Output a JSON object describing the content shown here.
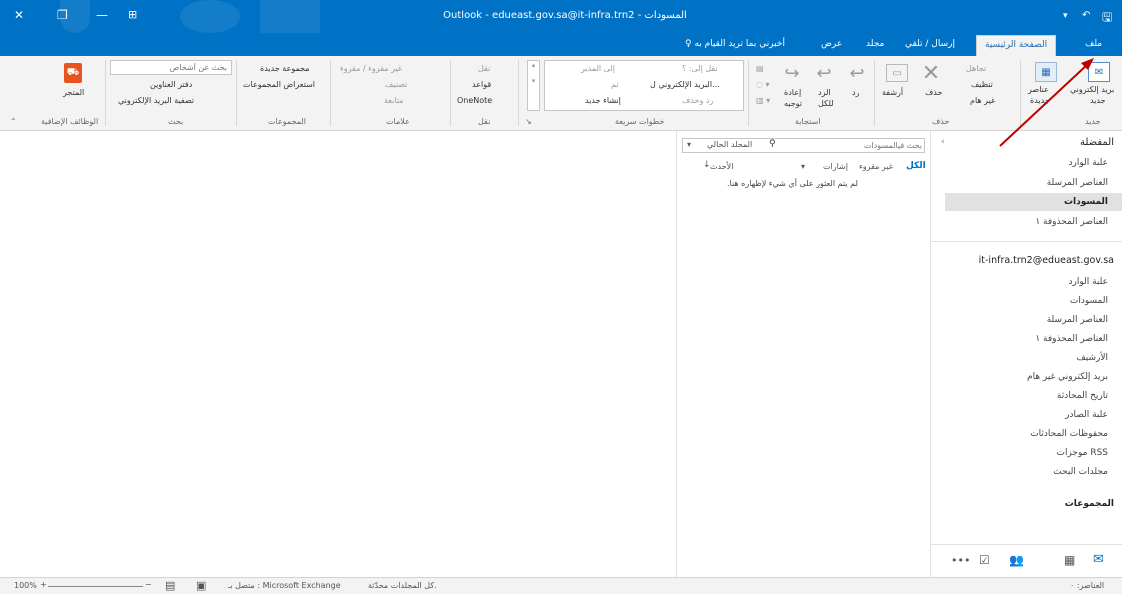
{
  "window": {
    "title": "Outlook - edueast.gov.sa@it-infra.trn2 - المسودات",
    "controls": {
      "close": "✕",
      "restore": "❐",
      "minimize": "—"
    }
  },
  "tabs": {
    "file": "ملف",
    "home": "الصفحة الرئيسية",
    "send_receive": "إرسال / تلقي",
    "folder": "مجلد",
    "view": "عرض",
    "tell_me": "أخبرني بما تريد القيام به"
  },
  "ribbon": {
    "new": {
      "label": "جديد",
      "new_email": "بريد إلكتروني",
      "new_email_line2": "جديد",
      "new_items": "عناصر",
      "new_items_line2": "جديدة"
    },
    "delete": {
      "label": "حذف",
      "ignore": "تجاهل",
      "clean_up": "تنظيف",
      "junk": "غير هام",
      "delete_btn": "حذف",
      "archive": "أرشفة"
    },
    "respond": {
      "label": "استجابة",
      "reply": "رد",
      "reply_all": "الرد",
      "reply_all_line2": "للكل",
      "forward": "إعادة",
      "forward_line2": "توجيه"
    },
    "quick_steps": {
      "label": "خطوات سريعة",
      "move_to": "نقل إلى: ؟",
      "to_manager": "إلى المدير",
      "email_team": "البريد الإلكتروني ل...",
      "done": "تم",
      "reply_delete": "رد وحذف",
      "create_new": "إنشاء جديد"
    },
    "move": {
      "label": "نقل",
      "move_btn": "نقل",
      "rules": "قواعد",
      "onenote": "OneNote"
    },
    "tags": {
      "label": "علامات",
      "unread_read": "غير مقروء / مقروء",
      "categorize": "تصنيف",
      "follow_up": "متابعة"
    },
    "groups": {
      "label": "المجموعات",
      "new_group": "مجموعة جديدة",
      "browse_groups": "استعراض المجموعات"
    },
    "find": {
      "label": "بحث",
      "search_people_placeholder": "بحث عن أشخاص",
      "address_book": "دفتر العناوين",
      "filter_email": "تصفية البريد الإلكتروني"
    },
    "addins": {
      "label": "الوظائف الإضافية",
      "store": "المتجر"
    }
  },
  "nav": {
    "favorites": "المفضلة",
    "favorites_items": [
      {
        "label": "علبة الوارد"
      },
      {
        "label": "العناصر المرسلة"
      },
      {
        "label": "المسودات"
      },
      {
        "label": "العناصر المحذوفة ١"
      }
    ],
    "account": "it-infra.trn2@edueast.gov.sa",
    "account_items": [
      {
        "label": "علبة الوارد"
      },
      {
        "label": "المسودات"
      },
      {
        "label": "العناصر المرسلة"
      },
      {
        "label": "العناصر المحذوفة ١"
      },
      {
        "label": "الأرشيف"
      },
      {
        "label": "بريد إلكتروني غير هام"
      },
      {
        "label": "تاريخ المحادثة"
      },
      {
        "label": "علبة الصادر"
      },
      {
        "label": "محفوظات المحادثات"
      },
      {
        "label": "موجزات RSS"
      },
      {
        "label": "مجلدات البحث"
      }
    ],
    "groups": "المجموعات"
  },
  "list": {
    "search_placeholder": "بحث فيالمسودات",
    "scope": "المجلد الحالي",
    "filter_all": "الكل",
    "filter_unread": "غير مقروء",
    "filter_mentions": "إشارات",
    "sort": "الأحدث",
    "empty": "لم يتم العثور على أي شيء لإظهاره هنا."
  },
  "status": {
    "items": "العناصر: ٠",
    "folders": "كل المجلدات محدّثة.",
    "connection": "متصل بـ : Microsoft Exchange",
    "zoom": "100%"
  },
  "colors": {
    "accent": "#0072c6",
    "annotation": "#c00000"
  }
}
